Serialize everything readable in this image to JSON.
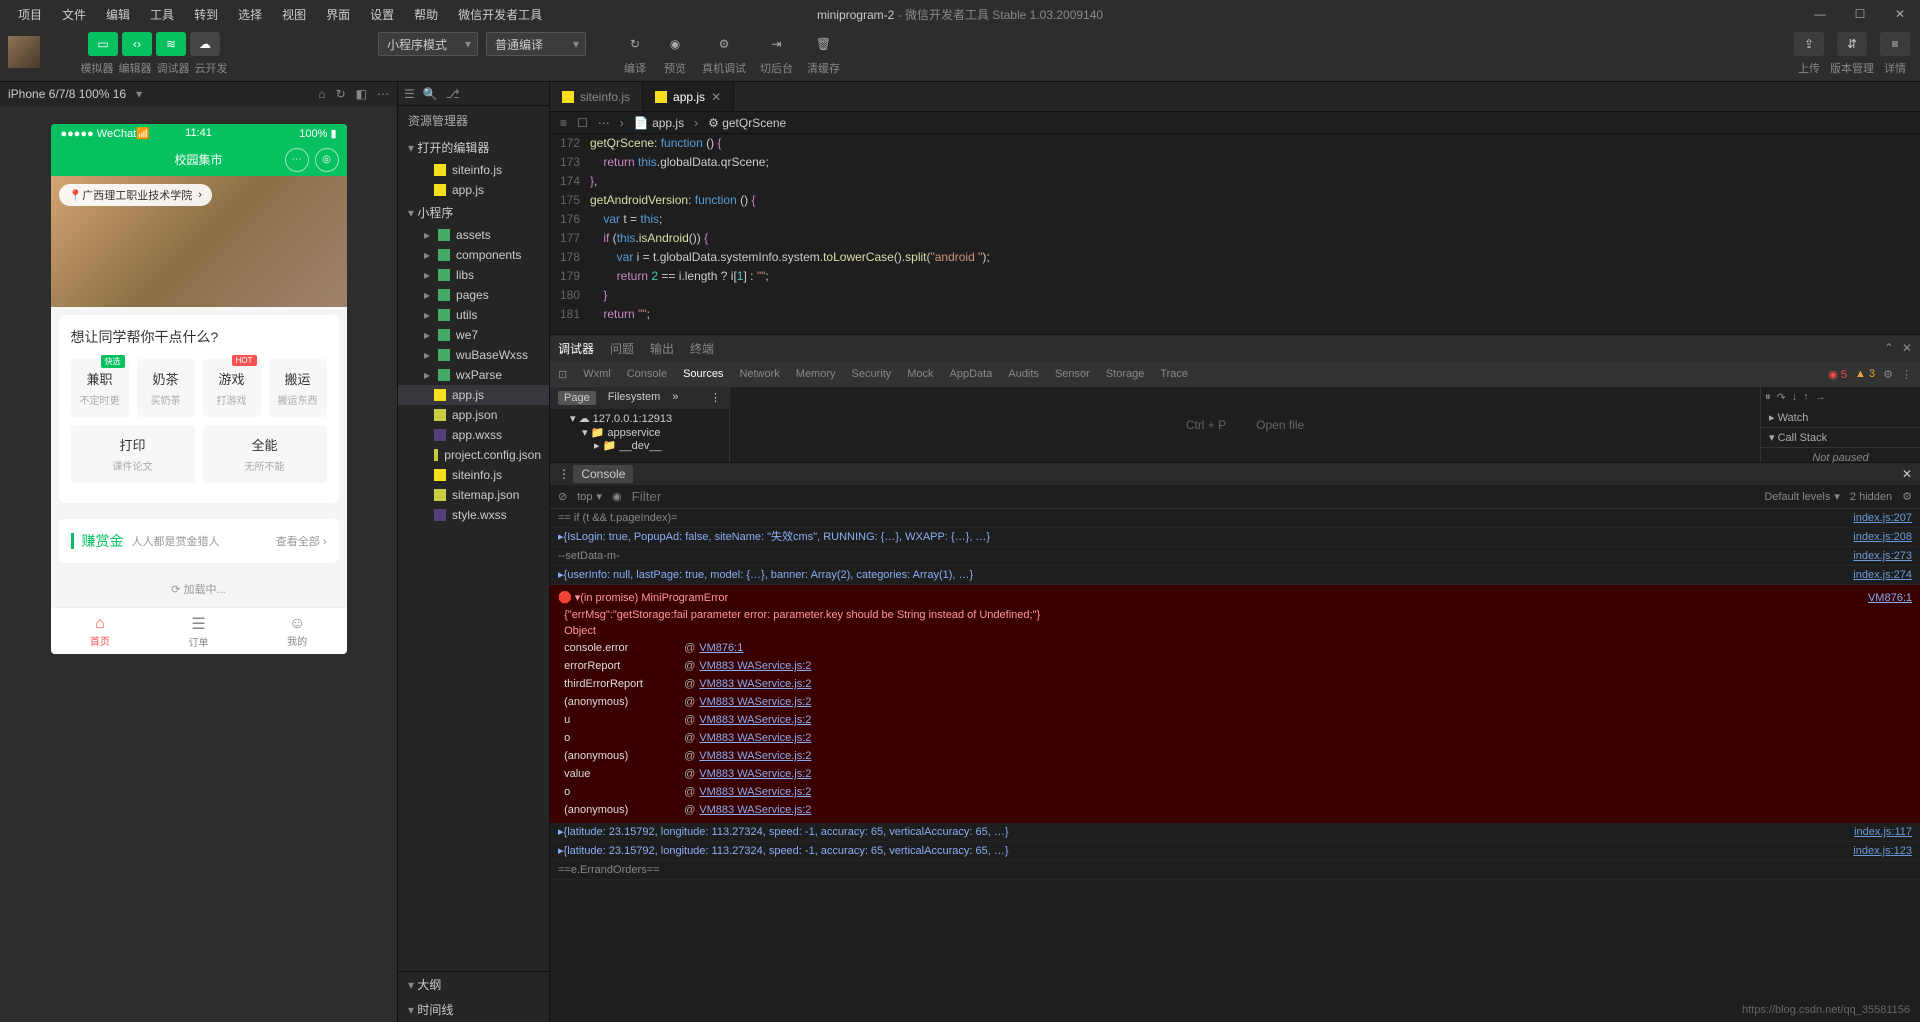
{
  "window": {
    "title_main": "miniprogram-2",
    "title_sub": " - 微信开发者工具 Stable 1.03.2009140"
  },
  "menu": [
    "项目",
    "文件",
    "编辑",
    "工具",
    "转到",
    "选择",
    "视图",
    "界面",
    "设置",
    "帮助",
    "微信开发者工具"
  ],
  "toolbar": {
    "group_labels": [
      "模拟器",
      "编辑器",
      "调试器",
      "云开发"
    ],
    "mode_select": "小程序模式",
    "compile_select": "普通编译",
    "center": [
      {
        "icon": "↻",
        "label": "编译"
      },
      {
        "icon": "◉",
        "label": "预览"
      },
      {
        "icon": "⚙",
        "label": "真机调试"
      },
      {
        "icon": "⇥",
        "label": "切后台"
      },
      {
        "icon": "🗑",
        "label": "清缓存"
      }
    ],
    "right": [
      {
        "icon": "⇪",
        "label": "上传"
      },
      {
        "icon": "⇵",
        "label": "版本管理"
      },
      {
        "icon": "≡",
        "label": "详情"
      }
    ]
  },
  "simulator": {
    "device": "iPhone 6/7/8 100% 16",
    "status": {
      "carrier": "●●●●● WeChat",
      "time": "11:41",
      "battery": "100%"
    },
    "nav_title": "校园集市",
    "location_chip": "广西理工职业技术学院",
    "card_title": "想让同学帮你干点什么?",
    "tiles": [
      [
        {
          "t1": "兼职",
          "t2": "不定时更",
          "badge": "快选",
          "bc": "green"
        },
        {
          "t1": "奶茶",
          "t2": "买奶茶"
        },
        {
          "t1": "游戏",
          "t2": "打游戏",
          "badge": "HOT",
          "bc": "red"
        },
        {
          "t1": "搬运",
          "t2": "搬运东西"
        }
      ],
      [
        {
          "t1": "打印",
          "t2": "课件论文"
        },
        {
          "t1": "全能",
          "t2": "无所不能"
        }
      ]
    ],
    "bonus": {
      "title": "赚赏金",
      "sub": "人人都是赏金猎人",
      "more": "查看全部 ›"
    },
    "loading": "加载中...",
    "tabbar": [
      {
        "ic": "⌂",
        "l": "首页"
      },
      {
        "ic": "☰",
        "l": "订单"
      },
      {
        "ic": "☺",
        "l": "我的"
      }
    ]
  },
  "explorer": {
    "title": "资源管理器",
    "sections": {
      "open_editors": "打开的编辑器",
      "project": "小程序",
      "outline": "大纲",
      "timeline": "时间线"
    },
    "open_editors": [
      {
        "icon": "js",
        "name": "siteinfo.js"
      },
      {
        "icon": "js",
        "name": "app.js"
      }
    ],
    "tree": [
      {
        "t": "folder",
        "name": "assets"
      },
      {
        "t": "folder",
        "name": "components"
      },
      {
        "t": "folder",
        "name": "libs"
      },
      {
        "t": "folder",
        "name": "pages"
      },
      {
        "t": "folder",
        "name": "utils"
      },
      {
        "t": "folder",
        "name": "we7"
      },
      {
        "t": "folder",
        "name": "wuBaseWxss"
      },
      {
        "t": "folder",
        "name": "wxParse"
      },
      {
        "t": "file",
        "icon": "js",
        "name": "app.js",
        "sel": true
      },
      {
        "t": "file",
        "icon": "json",
        "name": "app.json"
      },
      {
        "t": "file",
        "icon": "wxss",
        "name": "app.wxss"
      },
      {
        "t": "file",
        "icon": "json",
        "name": "project.config.json"
      },
      {
        "t": "file",
        "icon": "js",
        "name": "siteinfo.js"
      },
      {
        "t": "file",
        "icon": "json",
        "name": "sitemap.json"
      },
      {
        "t": "file",
        "icon": "wxss",
        "name": "style.wxss"
      }
    ]
  },
  "editor": {
    "tabs": [
      {
        "name": "siteinfo.js"
      },
      {
        "name": "app.js",
        "active": true
      }
    ],
    "breadcrumb": [
      "app.js",
      "getQrScene"
    ],
    "lines": [
      {
        "n": 172,
        "h": "<span class='k-yellow'>getQrScene</span>: <span class='k-blue'>function</span> () <span class='k-purple'>{</span>"
      },
      {
        "n": 173,
        "h": "    <span class='k-purple'>return</span> <span class='k-blue'>this</span>.globalData.qrScene;"
      },
      {
        "n": 174,
        "h": "<span class='k-purple'>}</span>,"
      },
      {
        "n": 175,
        "h": "<span class='k-yellow'>getAndroidVersion</span>: <span class='k-blue'>function</span> () <span class='k-purple'>{</span>"
      },
      {
        "n": 176,
        "h": "    <span class='k-blue'>var</span> t = <span class='k-blue'>this</span>;"
      },
      {
        "n": 177,
        "h": "    <span class='k-purple'>if</span> (<span class='k-blue'>this</span>.<span class='k-yellow'>isAndroid</span>()) <span class='k-purple'>{</span>"
      },
      {
        "n": 178,
        "h": "        <span class='k-blue'>var</span> i = t.globalData.systemInfo.system.<span class='k-yellow'>toLowerCase</span>().<span class='k-yellow'>split</span>(<span class='k-orange'>\"android \"</span>);"
      },
      {
        "n": 179,
        "h": "        <span class='k-purple'>return</span> <span class='k-cyan'>2</span> == i.length ? i[<span class='k-cyan'>1</span>] : <span class='k-orange'>\"\"</span>;"
      },
      {
        "n": 180,
        "h": "    <span class='k-purple'>}</span>"
      },
      {
        "n": 181,
        "h": "    <span class='k-purple'>return</span> <span class='k-orange'>\"\"</span>;"
      }
    ]
  },
  "debugger": {
    "tabs": [
      "调试器",
      "问题",
      "输出",
      "终端"
    ],
    "devtools_tabs": [
      "Wxml",
      "Console",
      "Sources",
      "Network",
      "Memory",
      "Security",
      "Mock",
      "AppData",
      "Audits",
      "Sensor",
      "Storage",
      "Trace"
    ],
    "devtools_active": "Sources",
    "warn_count": "3",
    "err_count": "5",
    "sources": {
      "left_tabs": [
        "Page",
        "Filesystem",
        "»"
      ],
      "tree": [
        {
          "l": "127.0.0.1:12913",
          "lv": 0
        },
        {
          "l": "appservice",
          "lv": 1
        },
        {
          "l": "__dev__",
          "lv": 2
        }
      ],
      "hint_left": "Ctrl + P",
      "hint_right": "Open file",
      "watch": "Watch",
      "callstack": "Call Stack",
      "not_paused": "Not paused"
    },
    "console": {
      "label": "Console",
      "context": "top",
      "filter_ph": "Filter",
      "levels": "Default levels",
      "hidden": "2 hidden"
    },
    "logs": [
      {
        "type": "gray",
        "text": "== if (t && t.pageIndex)=",
        "src": "index.js:207"
      },
      {
        "type": "obj",
        "text": "▸{IsLogin: true, PopupAd: false, siteName: \"失效cms\", RUNNING: {…}, WXAPP: {…}, …}",
        "src": "index.js:208"
      },
      {
        "type": "gray",
        "text": "--setData-m-",
        "src": "index.js:273"
      },
      {
        "type": "obj",
        "text": "▸{userInfo: null, lastPage: true, model: {…}, banner: Array(2), categories: Array(1), …}",
        "src": "index.js:274"
      }
    ],
    "error": {
      "header": "▾(in promise) MiniProgramError",
      "body": "{\"errMsg\":\"getStorage:fail parameter error: parameter.key should be String instead of Undefined;\"}",
      "obj": "Object",
      "src": "VM876:1",
      "stack": [
        {
          "fn": "console.error",
          "lnk": "VM876:1"
        },
        {
          "fn": "errorReport",
          "lnk": "VM883 WAService.js:2"
        },
        {
          "fn": "thirdErrorReport",
          "lnk": "VM883 WAService.js:2"
        },
        {
          "fn": "(anonymous)",
          "lnk": "VM883 WAService.js:2"
        },
        {
          "fn": "u",
          "lnk": "VM883 WAService.js:2"
        },
        {
          "fn": "o",
          "lnk": "VM883 WAService.js:2"
        },
        {
          "fn": "(anonymous)",
          "lnk": "VM883 WAService.js:2"
        },
        {
          "fn": "value",
          "lnk": "VM883 WAService.js:2"
        },
        {
          "fn": "o",
          "lnk": "VM883 WAService.js:2"
        },
        {
          "fn": "(anonymous)",
          "lnk": "VM883 WAService.js:2"
        }
      ]
    },
    "logs_after": [
      {
        "type": "obj",
        "text": "▸{latitude: 23.15792, longitude: 113.27324, speed: -1, accuracy: 65, verticalAccuracy: 65, …}",
        "src": "index.js:117"
      },
      {
        "type": "obj",
        "text": "▸{latitude: 23.15792, longitude: 113.27324, speed: -1, accuracy: 65, verticalAccuracy: 65, …}",
        "src": "index.js:123"
      },
      {
        "type": "gray",
        "text": "==e.ErrandOrders==",
        "src": ""
      }
    ]
  },
  "watermark": "https://blog.csdn.net/qq_35581156"
}
